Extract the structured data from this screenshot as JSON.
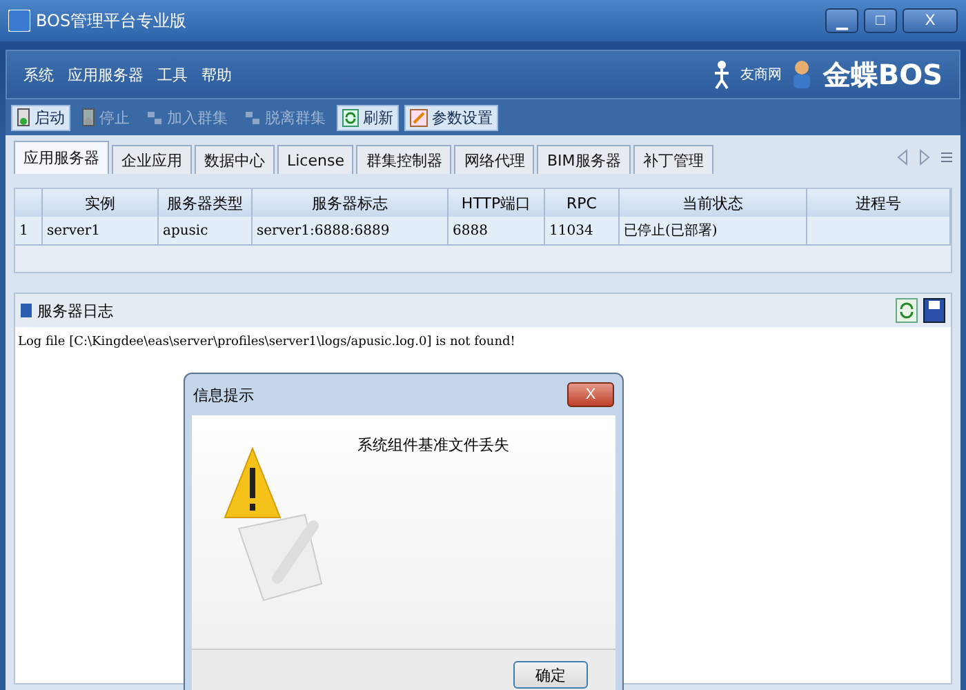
{
  "window": {
    "title": "BOS管理平台专业版",
    "controls": [
      "▁",
      "□",
      "X"
    ]
  },
  "menu": [
    "系统",
    "应用服务器",
    "工具",
    "帮助"
  ],
  "brand": {
    "small": "友商网",
    "main": "金蝶BOS"
  },
  "toolbar": [
    {
      "label": "启动",
      "kind": "start",
      "disabled": false
    },
    {
      "label": "停止",
      "kind": "stop",
      "disabled": true
    },
    {
      "label": "加入群集",
      "kind": "join",
      "disabled": true
    },
    {
      "label": "脱离群集",
      "kind": "leave",
      "disabled": true
    },
    {
      "label": "刷新",
      "kind": "refresh",
      "disabled": false
    },
    {
      "label": "参数设置",
      "kind": "settings",
      "disabled": false
    }
  ],
  "tabs": [
    {
      "label": "应用服务器",
      "selected": true
    },
    {
      "label": "企业应用",
      "selected": false
    },
    {
      "label": "数据中心",
      "selected": false
    },
    {
      "label": "License",
      "selected": false
    },
    {
      "label": "群集控制器",
      "selected": false
    },
    {
      "label": "网络代理",
      "selected": false
    },
    {
      "label": "BIM服务器",
      "selected": false
    },
    {
      "label": "补丁管理",
      "selected": false
    }
  ],
  "table": {
    "columns": [
      "实例",
      "服务器类型",
      "服务器标志",
      "HTTP端口",
      "RPC",
      "当前状态",
      "进程号"
    ],
    "rows": [
      {
        "index": "1",
        "cells": [
          "server1",
          "apusic",
          "server1:6888:6889",
          "6888",
          "11034",
          "已停止(已部署)",
          ""
        ]
      }
    ]
  },
  "log": {
    "title": "服务器日志",
    "lines": [
      "Log file [C:\\Kingdee\\eas\\server\\profiles\\server1\\logs/apusic.log.0] is not found!"
    ]
  },
  "dialog": {
    "title": "信息提示",
    "close": "X",
    "message": "系统组件基准文件丢失",
    "button": "确定"
  }
}
